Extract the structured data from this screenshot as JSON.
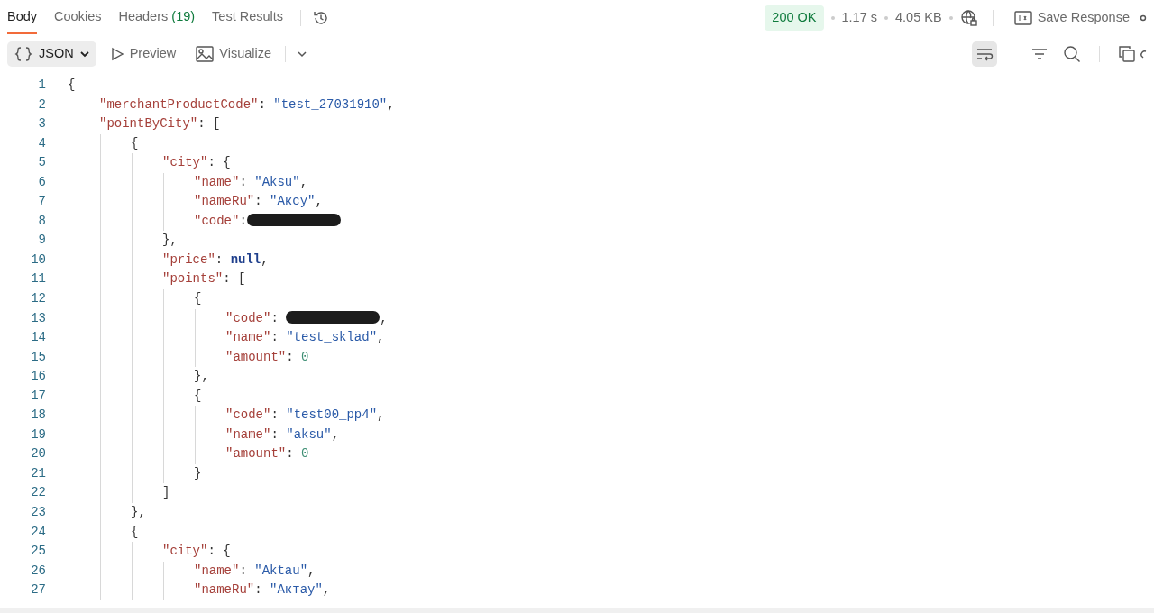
{
  "tabs": [
    {
      "label": "Body",
      "selected": true
    },
    {
      "label": "Cookies",
      "selected": false
    },
    {
      "label": "Headers",
      "count": "(19)",
      "selected": false
    },
    {
      "label": "Test Results",
      "selected": false
    }
  ],
  "status": {
    "code": "200 OK",
    "time": "1.17 s",
    "size": "4.05 KB"
  },
  "save_response": {
    "label": "Save Response"
  },
  "formats": [
    {
      "label": "JSON",
      "selected": true,
      "kind": "dropdown"
    },
    {
      "label": "Preview",
      "selected": false,
      "kind": "play"
    },
    {
      "label": "Visualize",
      "selected": false,
      "kind": "image"
    }
  ],
  "wrap_lines": {
    "on": true
  },
  "code": [
    {
      "number": "1",
      "tokens": [
        {
          "kind": "punct",
          "text": "{"
        }
      ],
      "children": [
        {
          "number": "2",
          "tokens": [
            {
              "kind": "key",
              "text": "\"merchantProductCode\""
            },
            {
              "kind": "punct",
              "text": ": "
            },
            {
              "kind": "string",
              "text": "\"test_27031910\""
            },
            {
              "kind": "punct",
              "text": ","
            }
          ]
        },
        {
          "number": "3",
          "tokens": [
            {
              "kind": "key",
              "text": "\"pointByCity\""
            },
            {
              "kind": "punct",
              "text": ": ["
            }
          ],
          "children": [
            {
              "number": "4",
              "tokens": [
                {
                  "kind": "punct",
                  "text": "{"
                }
              ],
              "children": [
                {
                  "number": "5",
                  "tokens": [
                    {
                      "kind": "key",
                      "text": "\"city\""
                    },
                    {
                      "kind": "punct",
                      "text": ": {"
                    }
                  ],
                  "children": [
                    {
                      "number": "6",
                      "tokens": [
                        {
                          "kind": "key",
                          "text": "\"name\""
                        },
                        {
                          "kind": "punct",
                          "text": ": "
                        },
                        {
                          "kind": "string",
                          "text": "\"Aksu\""
                        },
                        {
                          "kind": "punct",
                          "text": ","
                        }
                      ]
                    },
                    {
                      "number": "7",
                      "tokens": [
                        {
                          "kind": "key",
                          "text": "\"nameRu\""
                        },
                        {
                          "kind": "punct",
                          "text": ": "
                        },
                        {
                          "kind": "string",
                          "text": "\"Аксу\""
                        },
                        {
                          "kind": "punct",
                          "text": ","
                        }
                      ]
                    },
                    {
                      "number": "8",
                      "tokens": [
                        {
                          "kind": "key",
                          "text": "\"code\""
                        },
                        {
                          "kind": "punct",
                          "text": ":"
                        },
                        {
                          "kind": "redacted"
                        }
                      ]
                    }
                  ]
                },
                {
                  "number": "9",
                  "tokens": [
                    {
                      "kind": "punct",
                      "text": "},"
                    }
                  ]
                },
                {
                  "number": "10",
                  "tokens": [
                    {
                      "kind": "key",
                      "text": "\"price\""
                    },
                    {
                      "kind": "punct",
                      "text": ": "
                    },
                    {
                      "kind": "null",
                      "text": "null"
                    },
                    {
                      "kind": "punct",
                      "text": ","
                    }
                  ]
                },
                {
                  "number": "11",
                  "tokens": [
                    {
                      "kind": "key",
                      "text": "\"points\""
                    },
                    {
                      "kind": "punct",
                      "text": ": ["
                    }
                  ],
                  "children": [
                    {
                      "number": "12",
                      "tokens": [
                        {
                          "kind": "punct",
                          "text": "{"
                        }
                      ],
                      "children": [
                        {
                          "number": "13",
                          "tokens": [
                            {
                              "kind": "key",
                              "text": "\"code\""
                            },
                            {
                              "kind": "punct",
                              "text": ": "
                            },
                            {
                              "kind": "redacted"
                            },
                            {
                              "kind": "punct",
                              "text": ","
                            }
                          ]
                        },
                        {
                          "number": "14",
                          "tokens": [
                            {
                              "kind": "key",
                              "text": "\"name\""
                            },
                            {
                              "kind": "punct",
                              "text": ": "
                            },
                            {
                              "kind": "string",
                              "text": "\"test_sklad\""
                            },
                            {
                              "kind": "punct",
                              "text": ","
                            }
                          ]
                        },
                        {
                          "number": "15",
                          "tokens": [
                            {
                              "kind": "key",
                              "text": "\"amount\""
                            },
                            {
                              "kind": "punct",
                              "text": ": "
                            },
                            {
                              "kind": "number",
                              "text": "0"
                            }
                          ]
                        }
                      ]
                    },
                    {
                      "number": "16",
                      "tokens": [
                        {
                          "kind": "punct",
                          "text": "},"
                        }
                      ]
                    },
                    {
                      "number": "17",
                      "tokens": [
                        {
                          "kind": "punct",
                          "text": "{"
                        }
                      ],
                      "children": [
                        {
                          "number": "18",
                          "tokens": [
                            {
                              "kind": "key",
                              "text": "\"code\""
                            },
                            {
                              "kind": "punct",
                              "text": ": "
                            },
                            {
                              "kind": "string",
                              "text": "\"test00_pp4\""
                            },
                            {
                              "kind": "punct",
                              "text": ","
                            }
                          ]
                        },
                        {
                          "number": "19",
                          "tokens": [
                            {
                              "kind": "key",
                              "text": "\"name\""
                            },
                            {
                              "kind": "punct",
                              "text": ": "
                            },
                            {
                              "kind": "string",
                              "text": "\"aksu\""
                            },
                            {
                              "kind": "punct",
                              "text": ","
                            }
                          ]
                        },
                        {
                          "number": "20",
                          "tokens": [
                            {
                              "kind": "key",
                              "text": "\"amount\""
                            },
                            {
                              "kind": "punct",
                              "text": ": "
                            },
                            {
                              "kind": "number",
                              "text": "0"
                            }
                          ]
                        }
                      ]
                    },
                    {
                      "number": "21",
                      "tokens": [
                        {
                          "kind": "punct",
                          "text": "}"
                        }
                      ]
                    }
                  ]
                },
                {
                  "number": "22",
                  "tokens": [
                    {
                      "kind": "punct",
                      "text": "]"
                    }
                  ]
                }
              ]
            },
            {
              "number": "23",
              "tokens": [
                {
                  "kind": "punct",
                  "text": "},"
                }
              ]
            },
            {
              "number": "24",
              "tokens": [
                {
                  "kind": "punct",
                  "text": "{"
                }
              ],
              "children": [
                {
                  "number": "25",
                  "tokens": [
                    {
                      "kind": "key",
                      "text": "\"city\""
                    },
                    {
                      "kind": "punct",
                      "text": ": {"
                    }
                  ],
                  "children": [
                    {
                      "number": "26",
                      "tokens": [
                        {
                          "kind": "key",
                          "text": "\"name\""
                        },
                        {
                          "kind": "punct",
                          "text": ": "
                        },
                        {
                          "kind": "string",
                          "text": "\"Aktau\""
                        },
                        {
                          "kind": "punct",
                          "text": ","
                        }
                      ]
                    },
                    {
                      "number": "27",
                      "tokens": [
                        {
                          "kind": "key",
                          "text": "\"nameRu\""
                        },
                        {
                          "kind": "punct",
                          "text": ": "
                        },
                        {
                          "kind": "string",
                          "text": "\"Актау\""
                        },
                        {
                          "kind": "punct",
                          "text": ","
                        }
                      ]
                    }
                  ]
                }
              ]
            }
          ]
        }
      ]
    }
  ]
}
